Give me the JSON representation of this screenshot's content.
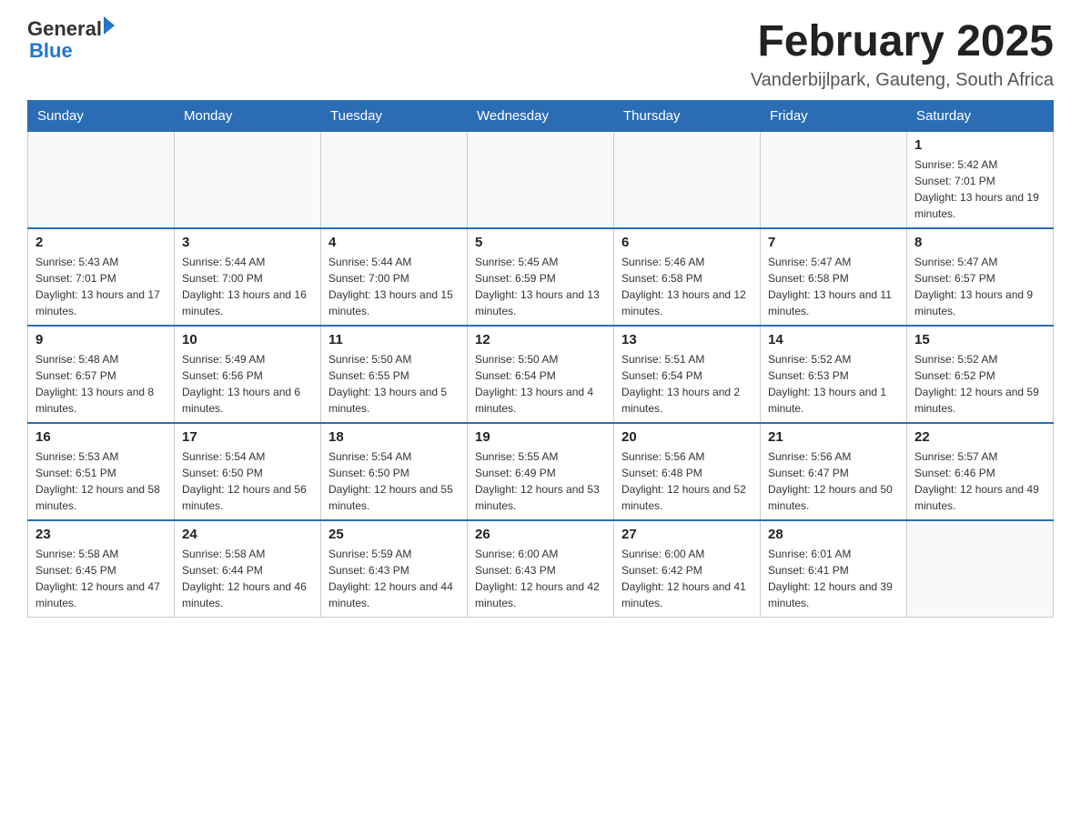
{
  "header": {
    "logo": {
      "text_general": "General",
      "text_blue": "Blue",
      "arrow": "▶"
    },
    "title": "February 2025",
    "location": "Vanderbijlpark, Gauteng, South Africa"
  },
  "weekdays": [
    "Sunday",
    "Monday",
    "Tuesday",
    "Wednesday",
    "Thursday",
    "Friday",
    "Saturday"
  ],
  "weeks": [
    [
      {
        "day": "",
        "info": ""
      },
      {
        "day": "",
        "info": ""
      },
      {
        "day": "",
        "info": ""
      },
      {
        "day": "",
        "info": ""
      },
      {
        "day": "",
        "info": ""
      },
      {
        "day": "",
        "info": ""
      },
      {
        "day": "1",
        "info": "Sunrise: 5:42 AM\nSunset: 7:01 PM\nDaylight: 13 hours and 19 minutes."
      }
    ],
    [
      {
        "day": "2",
        "info": "Sunrise: 5:43 AM\nSunset: 7:01 PM\nDaylight: 13 hours and 17 minutes."
      },
      {
        "day": "3",
        "info": "Sunrise: 5:44 AM\nSunset: 7:00 PM\nDaylight: 13 hours and 16 minutes."
      },
      {
        "day": "4",
        "info": "Sunrise: 5:44 AM\nSunset: 7:00 PM\nDaylight: 13 hours and 15 minutes."
      },
      {
        "day": "5",
        "info": "Sunrise: 5:45 AM\nSunset: 6:59 PM\nDaylight: 13 hours and 13 minutes."
      },
      {
        "day": "6",
        "info": "Sunrise: 5:46 AM\nSunset: 6:58 PM\nDaylight: 13 hours and 12 minutes."
      },
      {
        "day": "7",
        "info": "Sunrise: 5:47 AM\nSunset: 6:58 PM\nDaylight: 13 hours and 11 minutes."
      },
      {
        "day": "8",
        "info": "Sunrise: 5:47 AM\nSunset: 6:57 PM\nDaylight: 13 hours and 9 minutes."
      }
    ],
    [
      {
        "day": "9",
        "info": "Sunrise: 5:48 AM\nSunset: 6:57 PM\nDaylight: 13 hours and 8 minutes."
      },
      {
        "day": "10",
        "info": "Sunrise: 5:49 AM\nSunset: 6:56 PM\nDaylight: 13 hours and 6 minutes."
      },
      {
        "day": "11",
        "info": "Sunrise: 5:50 AM\nSunset: 6:55 PM\nDaylight: 13 hours and 5 minutes."
      },
      {
        "day": "12",
        "info": "Sunrise: 5:50 AM\nSunset: 6:54 PM\nDaylight: 13 hours and 4 minutes."
      },
      {
        "day": "13",
        "info": "Sunrise: 5:51 AM\nSunset: 6:54 PM\nDaylight: 13 hours and 2 minutes."
      },
      {
        "day": "14",
        "info": "Sunrise: 5:52 AM\nSunset: 6:53 PM\nDaylight: 13 hours and 1 minute."
      },
      {
        "day": "15",
        "info": "Sunrise: 5:52 AM\nSunset: 6:52 PM\nDaylight: 12 hours and 59 minutes."
      }
    ],
    [
      {
        "day": "16",
        "info": "Sunrise: 5:53 AM\nSunset: 6:51 PM\nDaylight: 12 hours and 58 minutes."
      },
      {
        "day": "17",
        "info": "Sunrise: 5:54 AM\nSunset: 6:50 PM\nDaylight: 12 hours and 56 minutes."
      },
      {
        "day": "18",
        "info": "Sunrise: 5:54 AM\nSunset: 6:50 PM\nDaylight: 12 hours and 55 minutes."
      },
      {
        "day": "19",
        "info": "Sunrise: 5:55 AM\nSunset: 6:49 PM\nDaylight: 12 hours and 53 minutes."
      },
      {
        "day": "20",
        "info": "Sunrise: 5:56 AM\nSunset: 6:48 PM\nDaylight: 12 hours and 52 minutes."
      },
      {
        "day": "21",
        "info": "Sunrise: 5:56 AM\nSunset: 6:47 PM\nDaylight: 12 hours and 50 minutes."
      },
      {
        "day": "22",
        "info": "Sunrise: 5:57 AM\nSunset: 6:46 PM\nDaylight: 12 hours and 49 minutes."
      }
    ],
    [
      {
        "day": "23",
        "info": "Sunrise: 5:58 AM\nSunset: 6:45 PM\nDaylight: 12 hours and 47 minutes."
      },
      {
        "day": "24",
        "info": "Sunrise: 5:58 AM\nSunset: 6:44 PM\nDaylight: 12 hours and 46 minutes."
      },
      {
        "day": "25",
        "info": "Sunrise: 5:59 AM\nSunset: 6:43 PM\nDaylight: 12 hours and 44 minutes."
      },
      {
        "day": "26",
        "info": "Sunrise: 6:00 AM\nSunset: 6:43 PM\nDaylight: 12 hours and 42 minutes."
      },
      {
        "day": "27",
        "info": "Sunrise: 6:00 AM\nSunset: 6:42 PM\nDaylight: 12 hours and 41 minutes."
      },
      {
        "day": "28",
        "info": "Sunrise: 6:01 AM\nSunset: 6:41 PM\nDaylight: 12 hours and 39 minutes."
      },
      {
        "day": "",
        "info": ""
      }
    ]
  ]
}
